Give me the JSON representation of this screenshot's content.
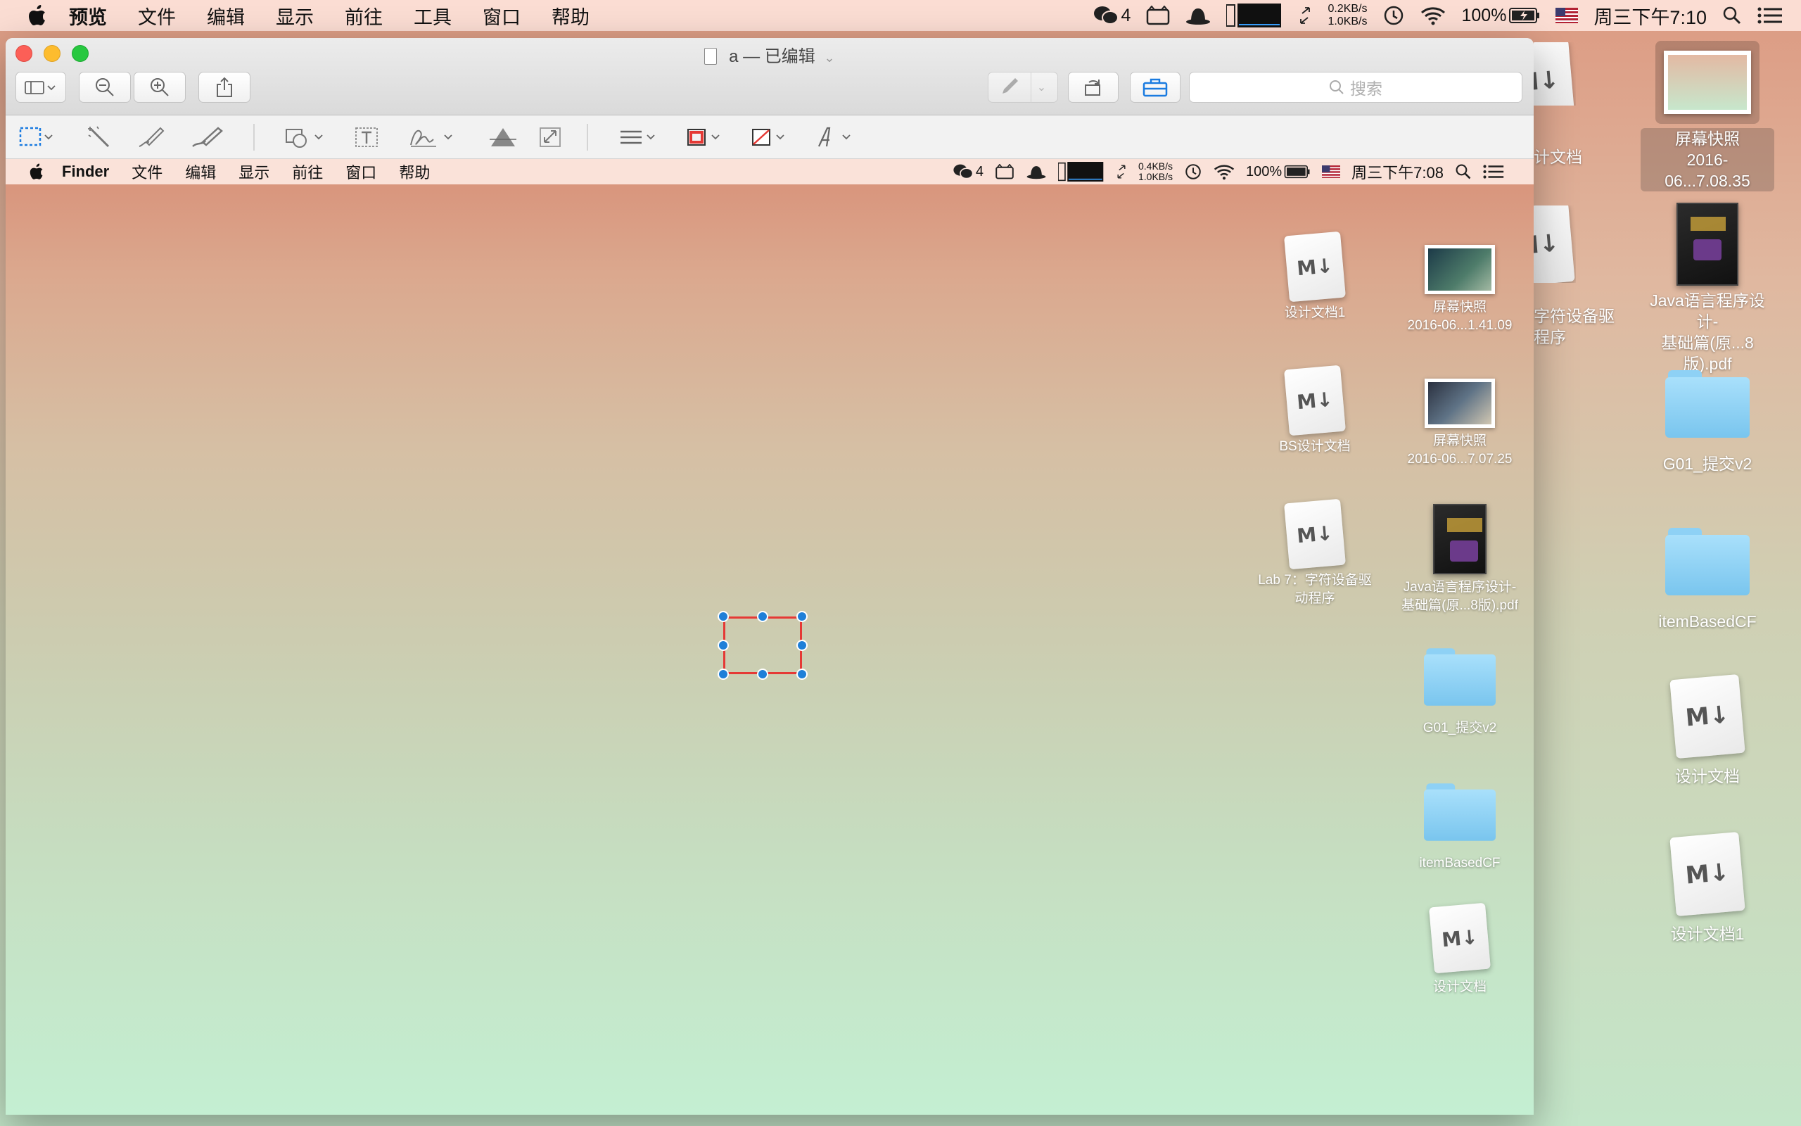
{
  "menubar": {
    "app_name": "预览",
    "items": [
      "文件",
      "编辑",
      "显示",
      "前往",
      "工具",
      "窗口",
      "帮助"
    ],
    "wechat_count": "4",
    "net_up": "0.2KB/s",
    "net_down": "1.0KB/s",
    "battery": "100%",
    "clock": "周三下午7:10"
  },
  "window": {
    "title": "a — 已编辑",
    "search_placeholder": "搜索"
  },
  "inner_menubar": {
    "app_name": "Finder",
    "items": [
      "文件",
      "编辑",
      "显示",
      "前往",
      "窗口",
      "帮助"
    ],
    "wechat_count": "4",
    "net_up": "0.4KB/s",
    "net_down": "1.0KB/s",
    "battery": "100%",
    "clock": "周三下午7:08"
  },
  "inner_icons": [
    {
      "label": "设计文档1",
      "kind": "md"
    },
    {
      "label": "屏幕快照\n2016-06...1.41.09",
      "kind": "shot"
    },
    {
      "label": "BS设计文档",
      "kind": "md"
    },
    {
      "label": "屏幕快照\n2016-06...7.07.25",
      "kind": "shot"
    },
    {
      "label": "Lab 7：字符设备驱\n动程序",
      "kind": "md"
    },
    {
      "label": "Java语言程序设计-\n基础篇(原...8版).pdf",
      "kind": "book"
    },
    {
      "label": "G01_提交v2",
      "kind": "folder"
    },
    {
      "label": "itemBasedCF",
      "kind": "folder"
    },
    {
      "label": "设计文档",
      "kind": "md"
    }
  ],
  "desktop_icons": [
    {
      "label": "屏幕快照\n2016-06...7.08.35",
      "kind": "shot"
    },
    {
      "label": "Java语言程序设计-\n基础篇(原...8版).pdf",
      "kind": "book"
    },
    {
      "label": "G01_提交v2",
      "kind": "folder"
    },
    {
      "label": "itemBasedCF",
      "kind": "folder"
    },
    {
      "label": "设计文档",
      "kind": "md"
    },
    {
      "label": "设计文档1",
      "kind": "md"
    }
  ],
  "peek_labels": [
    "计文档",
    "字符设备驱",
    "程序"
  ],
  "colors": {
    "selection": "#e53935",
    "handle": "#1e7fd8",
    "accent": "#1a7be0"
  }
}
